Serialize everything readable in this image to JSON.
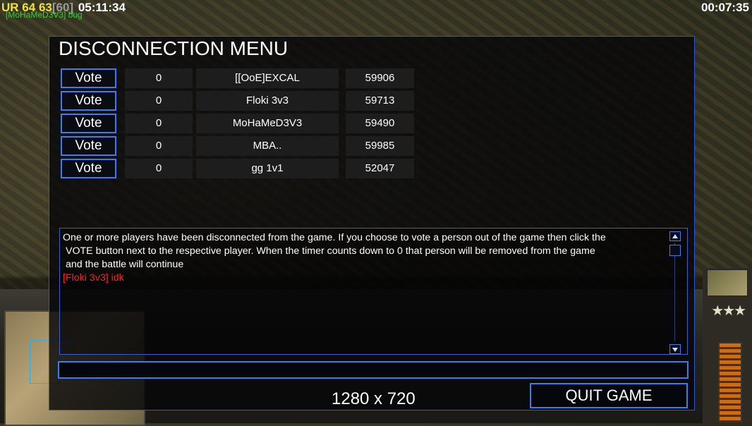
{
  "overlay": {
    "fps_label": "UR",
    "fps_current": "64",
    "fps_avg": "63",
    "fps_cap": "[60]",
    "clock": "05:11:34",
    "game_timer": "00:07:35",
    "player_tag": "[MoHaMeD3V3] bug"
  },
  "dialog": {
    "title": "DISCONNECTION MENU",
    "vote_label": "Vote",
    "players": [
      {
        "votes": "0",
        "name": "[[OoE]EXCAL",
        "ping": "59906"
      },
      {
        "votes": "0",
        "name": "Floki 3v3",
        "ping": "59713"
      },
      {
        "votes": "0",
        "name": "MoHaMeD3V3",
        "ping": "59490"
      },
      {
        "votes": "0",
        "name": "MBA..",
        "ping": "59985"
      },
      {
        "votes": "0",
        "name": "gg 1v1",
        "ping": "52047"
      }
    ],
    "message_line1": "One or more players have been disconnected from the game. If you choose to vote a person out of the game then click the",
    "message_line2": "VOTE button next to the respective player. When the timer counts down to 0 that person will be removed from the game",
    "message_line3": "and the battle will continue",
    "chat_line": "[Floki 3v3] idk",
    "chat_input_value": "",
    "quit_label": "QUIT GAME"
  },
  "resolution_label": "1280 x 720",
  "colors": {
    "border_blue": "#3b7cf0",
    "chat_red": "#ff2020",
    "fps_yellow": "#f2e235"
  }
}
